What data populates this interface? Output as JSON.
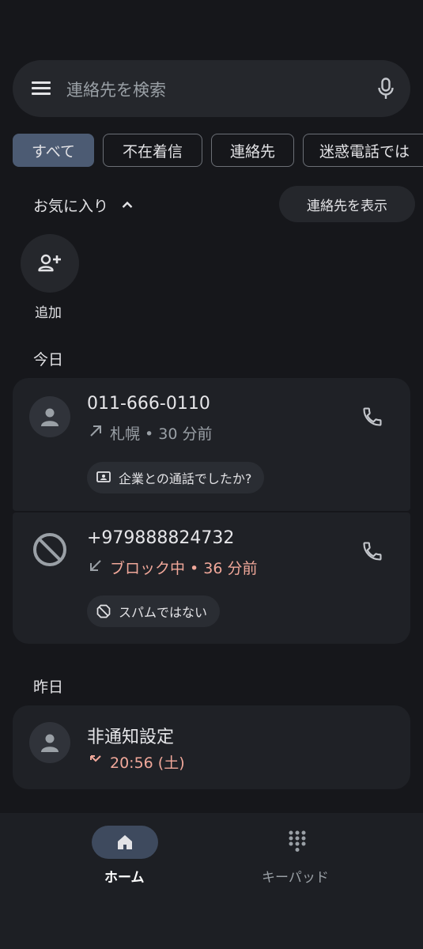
{
  "search": {
    "placeholder": "連絡先を検索"
  },
  "chips": [
    "すべて",
    "不在着信",
    "連絡先",
    "迷惑電話では"
  ],
  "favorites": {
    "title": "お気に入り",
    "show_contacts": "連絡先を表示",
    "add_label": "追加"
  },
  "sections": {
    "today": "今日",
    "yesterday": "昨日"
  },
  "calls": [
    {
      "number": "011-666-0110",
      "detail": "札幌 • 30 分前",
      "action": "企業との通話でしたか?"
    },
    {
      "number": "+979888824732",
      "detail": "ブロック中 • 36 分前",
      "action": "スパムではない"
    },
    {
      "number": "非通知設定",
      "detail": "20:56 (土)"
    }
  ],
  "nav": {
    "home": "ホーム",
    "keypad": "キーパッド"
  },
  "colors": {
    "background": "#16171b",
    "card": "#1f2126",
    "accent": "#4c5b73",
    "missed": "#f1a89a"
  }
}
